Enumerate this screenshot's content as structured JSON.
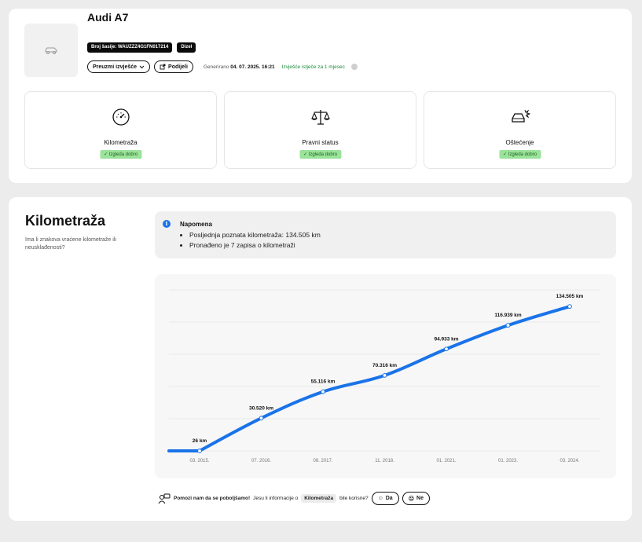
{
  "vehicle": {
    "title": "Audi A7",
    "vin_badge": "Broj šasije: WAUZZZ4G1FN017214",
    "fuel_badge": "Dizel"
  },
  "actions": {
    "download_label": "Preuzmi izvješće",
    "share_label": "Podijeli",
    "generated_prefix": "Generirano",
    "generated_date": "04. 07. 2025. 16:21",
    "expiry_text": "Izvješće istječe za 1 mjesec"
  },
  "stats": [
    {
      "label": "Kilometraža",
      "status": "Izgleda dobro",
      "icon": "speedometer-icon"
    },
    {
      "label": "Pravni status",
      "status": "Izgleda dobro",
      "icon": "scales-icon"
    },
    {
      "label": "Oštećenje",
      "status": "Izgleda dobro",
      "icon": "car-crash-icon"
    }
  ],
  "mileage_section": {
    "title": "Kilometraža",
    "subtitle": "Ima li znakova vraćene kilometraže ili neusklađenosti?",
    "note_title": "Napomena",
    "note_items": [
      "Posljednja poznata kilometraža: 134.505 km",
      "Pronađeno je 7 zapisa o kilometraži"
    ]
  },
  "chart_data": {
    "type": "line",
    "categories": [
      "03. 2015.",
      "07. 2016.",
      "08. 2017.",
      "11. 2018.",
      "01. 2021.",
      "01. 2023.",
      "03. 2024."
    ],
    "series": [
      {
        "values": [
          26,
          30520,
          55116,
          70316,
          94933,
          116939,
          134505
        ]
      }
    ],
    "data_labels": [
      "26 km",
      "30.520 km",
      "55.116 km",
      "70.316 km",
      "94.933 km",
      "116.939 km",
      "134.505 km"
    ],
    "ylim": [
      0,
      150000
    ],
    "grid": true,
    "line_color": "#1a73e8"
  },
  "feedback": {
    "prompt": "Pomozi nam da se poboljšamo!",
    "question_prefix": "Jesu li informacije o",
    "tag": "Kilometraža",
    "question_suffix": "bile korisne?",
    "yes_label": "Da",
    "no_label": "Ne"
  },
  "colors": {
    "ok_badge": "#9be39b",
    "accent": "#1a73e8"
  }
}
